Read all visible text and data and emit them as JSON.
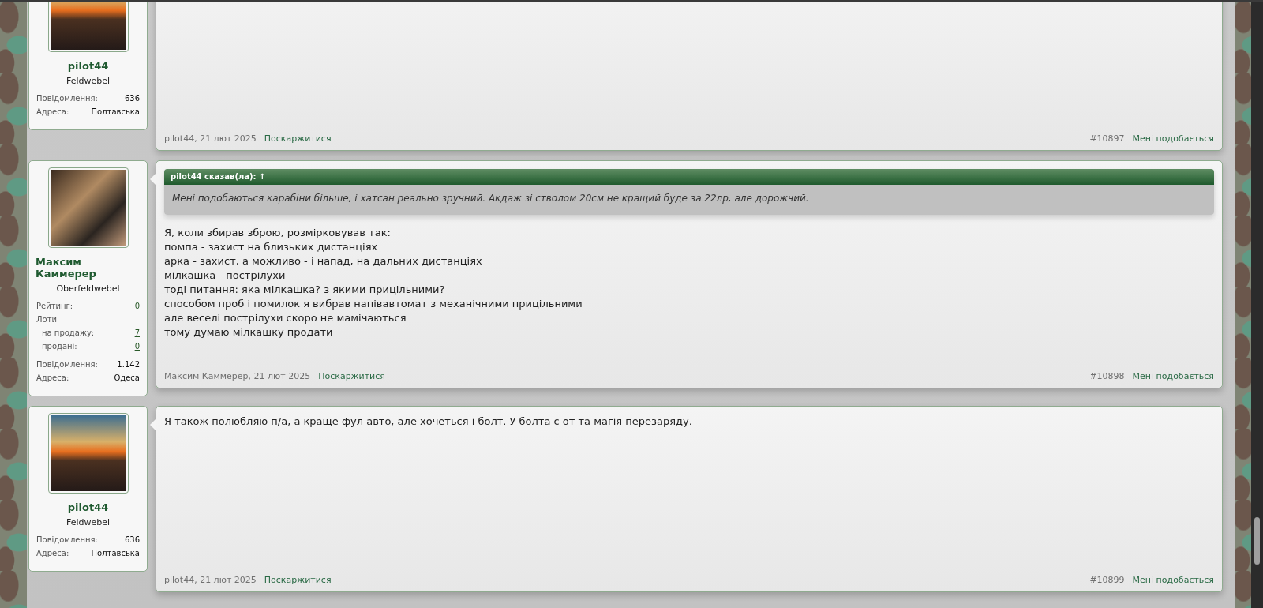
{
  "posts": [
    {
      "author": {
        "name": "pilot44",
        "rank": "Feldwebel",
        "fields": [
          {
            "label": "Повідомлення:",
            "value": "636"
          },
          {
            "label": "Адреса:",
            "value": "Полтавська"
          }
        ]
      },
      "footer": {
        "author_date": "pilot44, 21 лют 2025",
        "report": "Поскаржитися",
        "number": "#10897",
        "like": "Мені подобається"
      }
    },
    {
      "author": {
        "name": "Максим Каммерер",
        "rank": "Oberfeldwebel",
        "extra_fields": [
          {
            "kind": "link",
            "label": "Рейтинг:",
            "value": "0"
          },
          {
            "kind": "group",
            "label": "Лоти",
            "children": [
              {
                "kind": "link",
                "label": "на продажу:",
                "value": "7"
              },
              {
                "kind": "link",
                "label": "продані:",
                "value": "0"
              }
            ]
          }
        ],
        "fields": [
          {
            "label": "Повідомлення:",
            "value": "1.142"
          },
          {
            "label": "Адреса:",
            "value": "Одеса"
          }
        ]
      },
      "quote": {
        "attribution": "pilot44 сказав(ла): ↑",
        "text": "Мені подобаються карабіни більше, і хатсан реально зручний. Акдаж зі стволом 20см не кращий буде за 22лр, але дорожчий."
      },
      "body_lines": [
        "Я, коли збирав зброю, розмірковував так:",
        "помпа - захист на близьких дистанціях",
        "арка - захист, а можливо - і напад, на дальних дистанціях",
        "мілкашка - пострілухи",
        "тоді питання: яка мілкашка? з якими прицільними?",
        "способом проб і помилок я вибрав напівавтомат з механічними прицільними",
        "але веселі пострілухи скоро не мамічаються",
        "тому думаю мілкашку продати"
      ],
      "footer": {
        "author_date": "Максим Каммерер, 21 лют 2025",
        "report": "Поскаржитися",
        "number": "#10898",
        "like": "Мені подобається"
      }
    },
    {
      "author": {
        "name": "pilot44",
        "rank": "Feldwebel",
        "fields": [
          {
            "label": "Повідомлення:",
            "value": "636"
          },
          {
            "label": "Адреса:",
            "value": "Полтавська"
          }
        ]
      },
      "body_lines": [
        "Я також полюбляю п/а, а краще фул авто, але хочеться і болт. У болта є от та магія перезаряду."
      ],
      "footer": {
        "author_date": "pilot44, 21 лют 2025",
        "report": "Поскаржитися",
        "number": "#10899",
        "like": "Мені подобається"
      }
    }
  ]
}
